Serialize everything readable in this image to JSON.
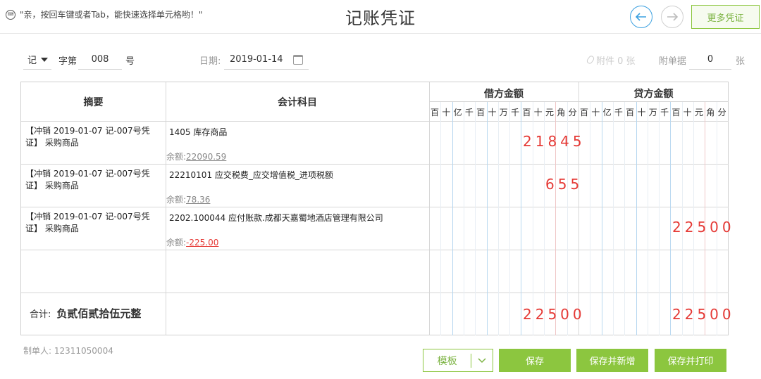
{
  "topbar": {
    "hint": "\"亲，按回车键或者Tab，能快速选择单元格哟！\"",
    "title": "记账凭证",
    "more_label": "更多凭证"
  },
  "meta": {
    "voucher_type": "记",
    "word_label": "字第",
    "number": "008",
    "number_suffix": "号",
    "date_label": "日期:",
    "date_value": "2019-01-14",
    "attachment_label": "附件 0 张",
    "doc_label": "附单据",
    "doc_count": "0",
    "doc_unit": "张"
  },
  "table": {
    "headers": {
      "summary": "摘要",
      "subject": "会计科目",
      "debit": "借方金额",
      "credit": "贷方金额"
    },
    "units": [
      "百",
      "十",
      "亿",
      "千",
      "百",
      "十",
      "万",
      "千",
      "百",
      "十",
      "元",
      "角",
      "分"
    ],
    "balance_label": "余额:",
    "rows": [
      {
        "summary": "【冲销 2019-01-07 记-007号凭证】 采购商品",
        "subject": "1405 库存商品",
        "balance": "22090.59",
        "debit": "21845",
        "credit": ""
      },
      {
        "summary": "【冲销 2019-01-07 记-007号凭证】 采购商品",
        "subject": "22210101 应交税费_应交增值税_进项税额",
        "balance": "78.36",
        "debit": "655",
        "credit": ""
      },
      {
        "summary": "【冲销 2019-01-07 记-007号凭证】 采购商品",
        "subject": "2202.100044 应付账款.成都天嘉蜀地酒店管理有限公司",
        "balance": "-225.00",
        "debit": "",
        "credit": "22500"
      }
    ],
    "total": {
      "label": "合计:",
      "amount_cn": "负贰佰贰拾伍元整",
      "debit": "22500",
      "credit": "22500"
    }
  },
  "footer": {
    "maker": "制单人: 12311050004",
    "template_label": "模板",
    "save_label": "保存",
    "save_new_label": "保存并新增",
    "save_print_label": "保存并打印"
  },
  "colors": {
    "accent_green": "#8cc63f",
    "nav_blue": "#3aa0e0",
    "amount_red": "#e53935"
  }
}
